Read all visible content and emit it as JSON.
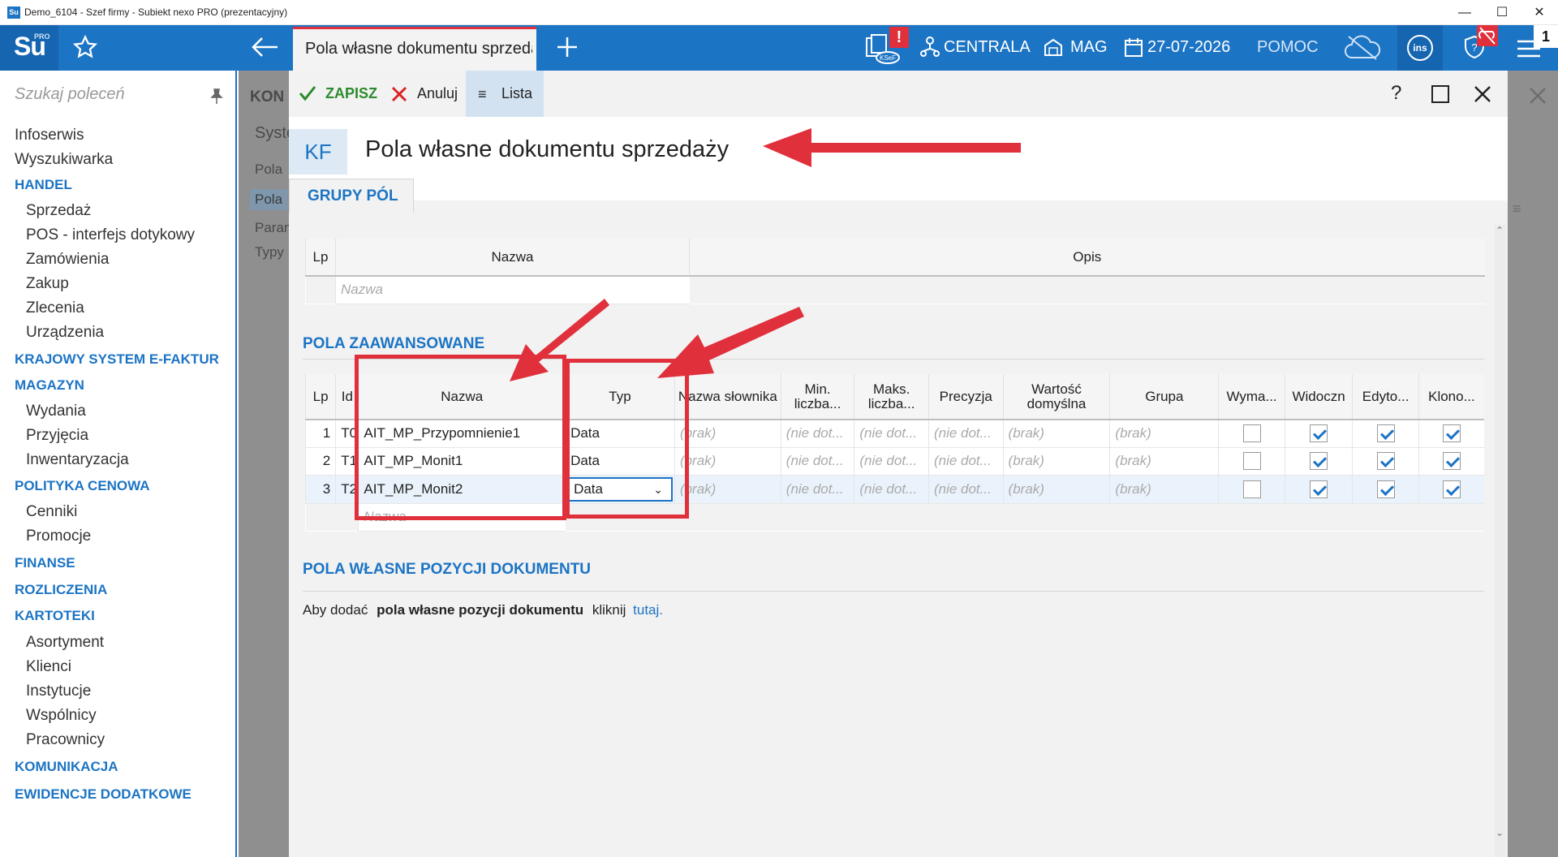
{
  "window": {
    "title": "Demo_6104 - Szef firmy - Subiekt nexo PRO (prezentacyjny)",
    "app_icon": "Su"
  },
  "topbar": {
    "logo": "Su",
    "logo_badge": "PRO",
    "active_tab": "Pola własne dokumentu sprzedaży",
    "ksef_badge": "KSeF",
    "branch": "CENTRALA",
    "warehouse": "MAG",
    "date": "27-07-2026",
    "help": "POMOC",
    "ins": "ins",
    "counter": "1"
  },
  "sidebar": {
    "search_placeholder": "Szukaj poleceń",
    "items": [
      {
        "label": "Infoserwis",
        "kind": "item"
      },
      {
        "label": "Wyszukiwarka",
        "kind": "item"
      },
      {
        "label": "HANDEL",
        "kind": "head"
      },
      {
        "label": "Sprzedaż",
        "kind": "sub"
      },
      {
        "label": "POS - interfejs dotykowy",
        "kind": "sub"
      },
      {
        "label": "Zamówienia",
        "kind": "sub"
      },
      {
        "label": "Zakup",
        "kind": "sub"
      },
      {
        "label": "Zlecenia",
        "kind": "sub"
      },
      {
        "label": "Urządzenia",
        "kind": "sub"
      },
      {
        "label": "KRAJOWY SYSTEM E-FAKTUR",
        "kind": "head"
      },
      {
        "label": "MAGAZYN",
        "kind": "head"
      },
      {
        "label": "Wydania",
        "kind": "sub"
      },
      {
        "label": "Przyjęcia",
        "kind": "sub"
      },
      {
        "label": "Inwentaryzacja",
        "kind": "sub"
      },
      {
        "label": "POLITYKA CENOWA",
        "kind": "head"
      },
      {
        "label": "Cenniki",
        "kind": "sub"
      },
      {
        "label": "Promocje",
        "kind": "sub"
      },
      {
        "label": "FINANSE",
        "kind": "head"
      },
      {
        "label": "ROZLICZENIA",
        "kind": "head"
      },
      {
        "label": "KARTOTEKI",
        "kind": "head"
      },
      {
        "label": "Asortyment",
        "kind": "sub"
      },
      {
        "label": "Klienci",
        "kind": "sub"
      },
      {
        "label": "Instytucje",
        "kind": "sub"
      },
      {
        "label": "Wspólnicy",
        "kind": "sub"
      },
      {
        "label": "Pracownicy",
        "kind": "sub"
      },
      {
        "label": "KOMUNIKACJA",
        "kind": "head"
      },
      {
        "label": "EWIDENCJE DODATKOWE",
        "kind": "head"
      }
    ]
  },
  "background_panel": {
    "heading": "KON",
    "subheading": "Syste",
    "items": [
      "Pola",
      "Pola",
      "Param",
      "Typy"
    ]
  },
  "toolbar": {
    "save": "ZAPISZ",
    "cancel": "Anuluj",
    "list": "Lista",
    "help": "?"
  },
  "form": {
    "badge": "KF",
    "title": "Pola własne dokumentu sprzedaży",
    "tab": "GRUPY PÓL",
    "groups_table": {
      "headers": [
        "Lp",
        "Nazwa",
        "Opis"
      ],
      "new_row_placeholder": "Nazwa"
    },
    "advanced": {
      "title": "POLA ZAAWANSOWANE",
      "headers": [
        "Lp",
        "Id",
        "Nazwa",
        "Typ",
        "Nazwa słownika",
        "Min. liczba...",
        "Maks. liczba...",
        "Precyzja",
        "Wartość domyślna",
        "Grupa",
        "Wyma...",
        "Widoczn",
        "Edyto...",
        "Klono..."
      ],
      "rows": [
        {
          "lp": "1",
          "id": "T0",
          "name": "AIT_MP_Przypomnienie1",
          "type": "Data",
          "dict": "(brak)",
          "min": "(nie dot...",
          "max": "(nie dot...",
          "prec": "(nie dot...",
          "def": "(brak)",
          "group": "(brak)",
          "req": false,
          "vis": true,
          "edit": true,
          "clone": true
        },
        {
          "lp": "2",
          "id": "T1",
          "name": "AIT_MP_Monit1",
          "type": "Data",
          "dict": "(brak)",
          "min": "(nie dot...",
          "max": "(nie dot...",
          "prec": "(nie dot...",
          "def": "(brak)",
          "group": "(brak)",
          "req": false,
          "vis": true,
          "edit": true,
          "clone": true
        },
        {
          "lp": "3",
          "id": "T2",
          "name": "AIT_MP_Monit2",
          "type": "Data",
          "dict": "(brak)",
          "min": "(nie dot...",
          "max": "(nie dot...",
          "prec": "(nie dot...",
          "def": "(brak)",
          "group": "(brak)",
          "req": false,
          "vis": true,
          "edit": true,
          "clone": true
        }
      ],
      "new_row_placeholder": "Nazwa"
    },
    "positions": {
      "title": "POLA WŁASNE POZYCJI DOKUMENTU",
      "text_before": "Aby dodać",
      "text_bold": "pola własne pozycji dokumentu",
      "text_after": "kliknij",
      "link": "tutaj."
    }
  },
  "colors": {
    "brand": "#1c74c4",
    "annotation": "#e0303c"
  }
}
